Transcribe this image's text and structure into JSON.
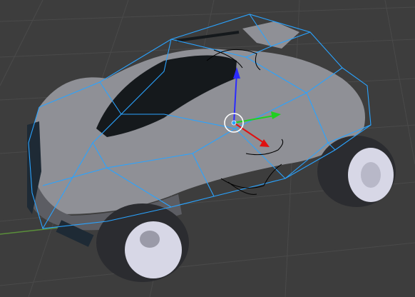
{
  "viewport": {
    "background": "#3d3d3d",
    "grid_color": "#4a4a4a",
    "x_axis_color": "#6e3a3a"
  },
  "model": {
    "body_color": "#8f9096",
    "body_shadow": "#5c5d63",
    "window_color": "#15191c",
    "tire_color": "#2b2c30",
    "rim_color": "#d7d7e6",
    "wireframe_color": "#2aa3ff",
    "curve_color": "#000000"
  },
  "gizmo": {
    "z_axis_color": "#2b2bff",
    "y_axis_color": "#20d020",
    "x_axis_color": "#e01010",
    "center_color": "#ffffff"
  }
}
